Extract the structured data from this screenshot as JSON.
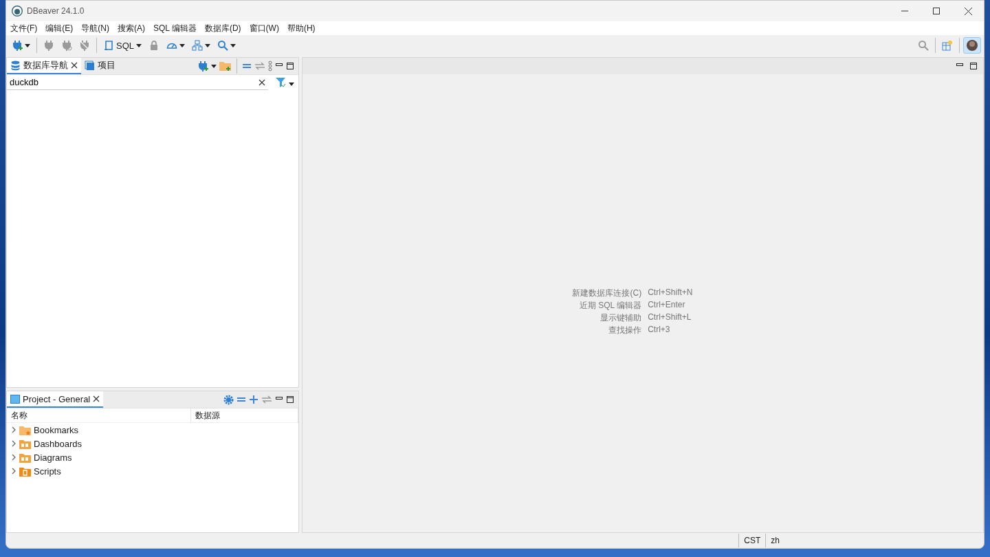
{
  "window": {
    "title": "DBeaver 24.1.0"
  },
  "menu": [
    "文件(F)",
    "编辑(E)",
    "导航(N)",
    "搜索(A)",
    "SQL 编辑器",
    "数据库(D)",
    "窗口(W)",
    "帮助(H)"
  ],
  "toolbar": [
    {
      "kind": "new-connection",
      "disabled": false,
      "dropdown": true
    },
    {
      "kind": "separator"
    },
    {
      "kind": "connect",
      "disabled": true,
      "dropdown": false
    },
    {
      "kind": "reconnect",
      "disabled": true,
      "dropdown": false
    },
    {
      "kind": "disconnect",
      "disabled": true,
      "dropdown": false
    },
    {
      "kind": "separator"
    },
    {
      "kind": "sql",
      "label": "SQL",
      "disabled": false,
      "dropdown": true
    },
    {
      "kind": "lock",
      "disabled": true,
      "dropdown": false
    },
    {
      "kind": "gauge",
      "disabled": false,
      "dropdown": true
    },
    {
      "kind": "hierarchy",
      "disabled": false,
      "dropdown": true
    },
    {
      "kind": "search",
      "disabled": false,
      "dropdown": true
    }
  ],
  "navigator": {
    "tabs": [
      {
        "label": "数据库导航",
        "selected": true,
        "closable": true,
        "kind": "database"
      },
      {
        "label": "项目",
        "selected": false,
        "closable": false,
        "kind": "project"
      }
    ],
    "filter": {
      "value": "duckdb"
    }
  },
  "project_panel": {
    "title": "Project - General",
    "columns": [
      "名称",
      "数据源"
    ],
    "items": [
      {
        "label": "Bookmarks",
        "kind": "bookmarks",
        "expanded": false
      },
      {
        "label": "Dashboards",
        "kind": "dashboards",
        "expanded": false
      },
      {
        "label": "Diagrams",
        "kind": "diagrams",
        "expanded": false
      },
      {
        "label": "Scripts",
        "kind": "scripts",
        "expanded": false
      }
    ]
  },
  "editor_hints": [
    {
      "action": "新建数据库连接(C)",
      "shortcut": "Ctrl+Shift+N"
    },
    {
      "action": "近期 SQL 编辑器",
      "shortcut": "Ctrl+Enter"
    },
    {
      "action": "显示键辅助",
      "shortcut": "Ctrl+Shift+L"
    },
    {
      "action": "查找操作",
      "shortcut": "Ctrl+3"
    }
  ],
  "status_bar": [
    "CST",
    "zh"
  ]
}
